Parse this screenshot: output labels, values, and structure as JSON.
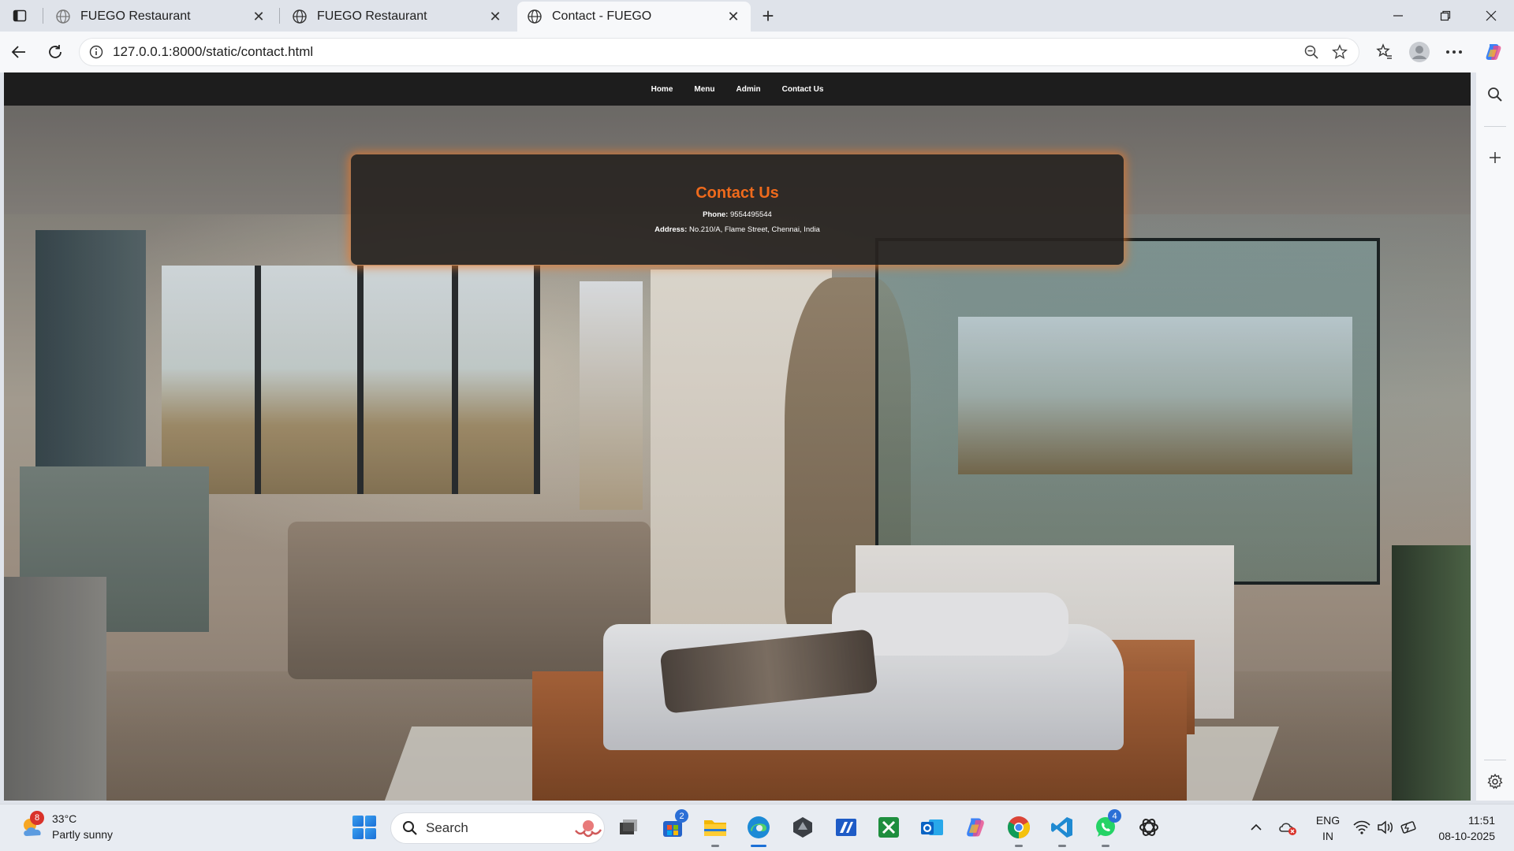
{
  "browser": {
    "tabs": [
      {
        "title": "FUEGO Restaurant",
        "active": false
      },
      {
        "title": "FUEGO Restaurant",
        "active": false
      },
      {
        "title": "Contact - FUEGO",
        "active": true
      }
    ],
    "url": "127.0.0.1:8000/static/contact.html",
    "icons": {
      "tab_actions": "tab-actions-icon",
      "new_tab": "plus-icon",
      "back": "back-arrow-icon",
      "refresh": "refresh-icon",
      "site_info": "info-icon",
      "zoom": "zoom-out-icon",
      "favorite": "star-icon",
      "favorites": "favorites-icon",
      "profile": "profile-icon",
      "more": "more-icon",
      "copilot": "copilot-icon"
    }
  },
  "site": {
    "nav": [
      "Home",
      "Menu",
      "Admin",
      "Contact Us"
    ],
    "contact": {
      "title": "Contact Us",
      "phone_label": "Phone:",
      "phone": "9554495544",
      "address_label": "Address:",
      "address": "No.210/A, Flame Street, Chennai, India"
    },
    "colors": {
      "accent": "#ef6a1c",
      "nav_bg": "#1d1d1d"
    }
  },
  "sidebar": {
    "icons": [
      "search-icon",
      "plus-icon",
      "settings-icon"
    ]
  },
  "taskbar": {
    "weather": {
      "badge": "8",
      "temp": "33°C",
      "condition": "Partly sunny"
    },
    "search_label": "Search",
    "badges": {
      "store": "2",
      "whatsapp": "4"
    },
    "lang": {
      "line1": "ENG",
      "line2": "IN"
    },
    "clock": {
      "time": "11:51",
      "date": "08-10-2025"
    }
  }
}
